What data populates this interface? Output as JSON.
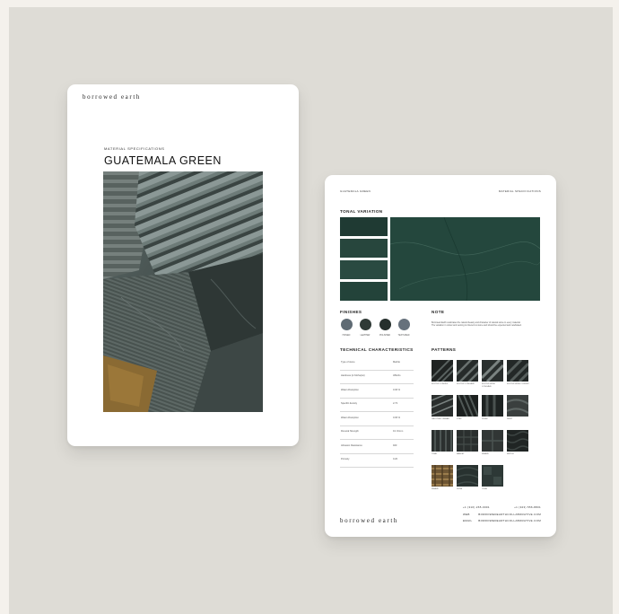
{
  "cover": {
    "brand": "borrowed earth",
    "eyebrow": "MATERIAL SPECIFICATIONS",
    "title": "GUATEMALA GREEN"
  },
  "sheet": {
    "header_left": "GUATEMALA GREEN",
    "header_right": "MATERIAL SPECIFICATIONS",
    "tonal_heading": "TONAL VARIATION",
    "finishes_heading": "FINISHES",
    "finishes": [
      {
        "label": "HONED",
        "color": "#5f6b74"
      },
      {
        "label": "LEATHER",
        "color": "#2f3a36"
      },
      {
        "label": "POLISHED",
        "color": "#26302d"
      },
      {
        "label": "TEXTURED",
        "color": "#66717c"
      }
    ],
    "note_heading": "NOTE",
    "note_text": "Borrowed Earth celebrates the natural beauty and character of natural stone in every material. The variation in colour and veining is inherent to stone and should be expected and celebrated.",
    "tech_heading": "TECHNICAL CHARACTERISTICS",
    "tech_rows": [
      {
        "key": "Type of stone",
        "value": "Marble"
      },
      {
        "key": "Hardness (in Mohs/psi)",
        "value": "3/Mohs"
      },
      {
        "key": "Water Absorption",
        "value": "0.06 %"
      },
      {
        "key": "Specific density",
        "value": "2.73"
      },
      {
        "key": "Water Absorption",
        "value": "0.06 %"
      },
      {
        "key": "Flexural Strength",
        "value": "9.1 N/mm"
      },
      {
        "key": "Abrasion Resistance",
        "value": "920"
      },
      {
        "key": "Porosity",
        "value": "0.20"
      }
    ],
    "patterns_heading": "PATTERNS",
    "patterns": [
      {
        "label": "FLUTED CONVEX"
      },
      {
        "label": "FLUTED CONCAVE"
      },
      {
        "label": "FLUTED WIDE CONCAVE"
      },
      {
        "label": "FLUTED WIDE CONVEX"
      },
      {
        "label": "GROOVED LINEAR"
      },
      {
        "label": "STEP"
      },
      {
        "label": "PLEAT"
      },
      {
        "label": "DRIFT"
      },
      {
        "label": "TIDAL"
      },
      {
        "label": "BASKET"
      },
      {
        "label": "WEAVE"
      },
      {
        "label": "RIPPLE"
      },
      {
        "label": "WEAVE"
      },
      {
        "label": "DUNE"
      },
      {
        "label": "CUBE"
      }
    ],
    "phones": [
      "+1 (310) 265-0001",
      "+1 (323) 556-8831"
    ],
    "contacts": [
      {
        "label": "WEB",
        "value": "BORROWEDEARTHCOLLABORATIVE.COM"
      },
      {
        "label": "EMAIL",
        "value": "BORROWEDEARTHCOLLABORATIVE.COM"
      }
    ],
    "brand": "borrowed earth"
  }
}
